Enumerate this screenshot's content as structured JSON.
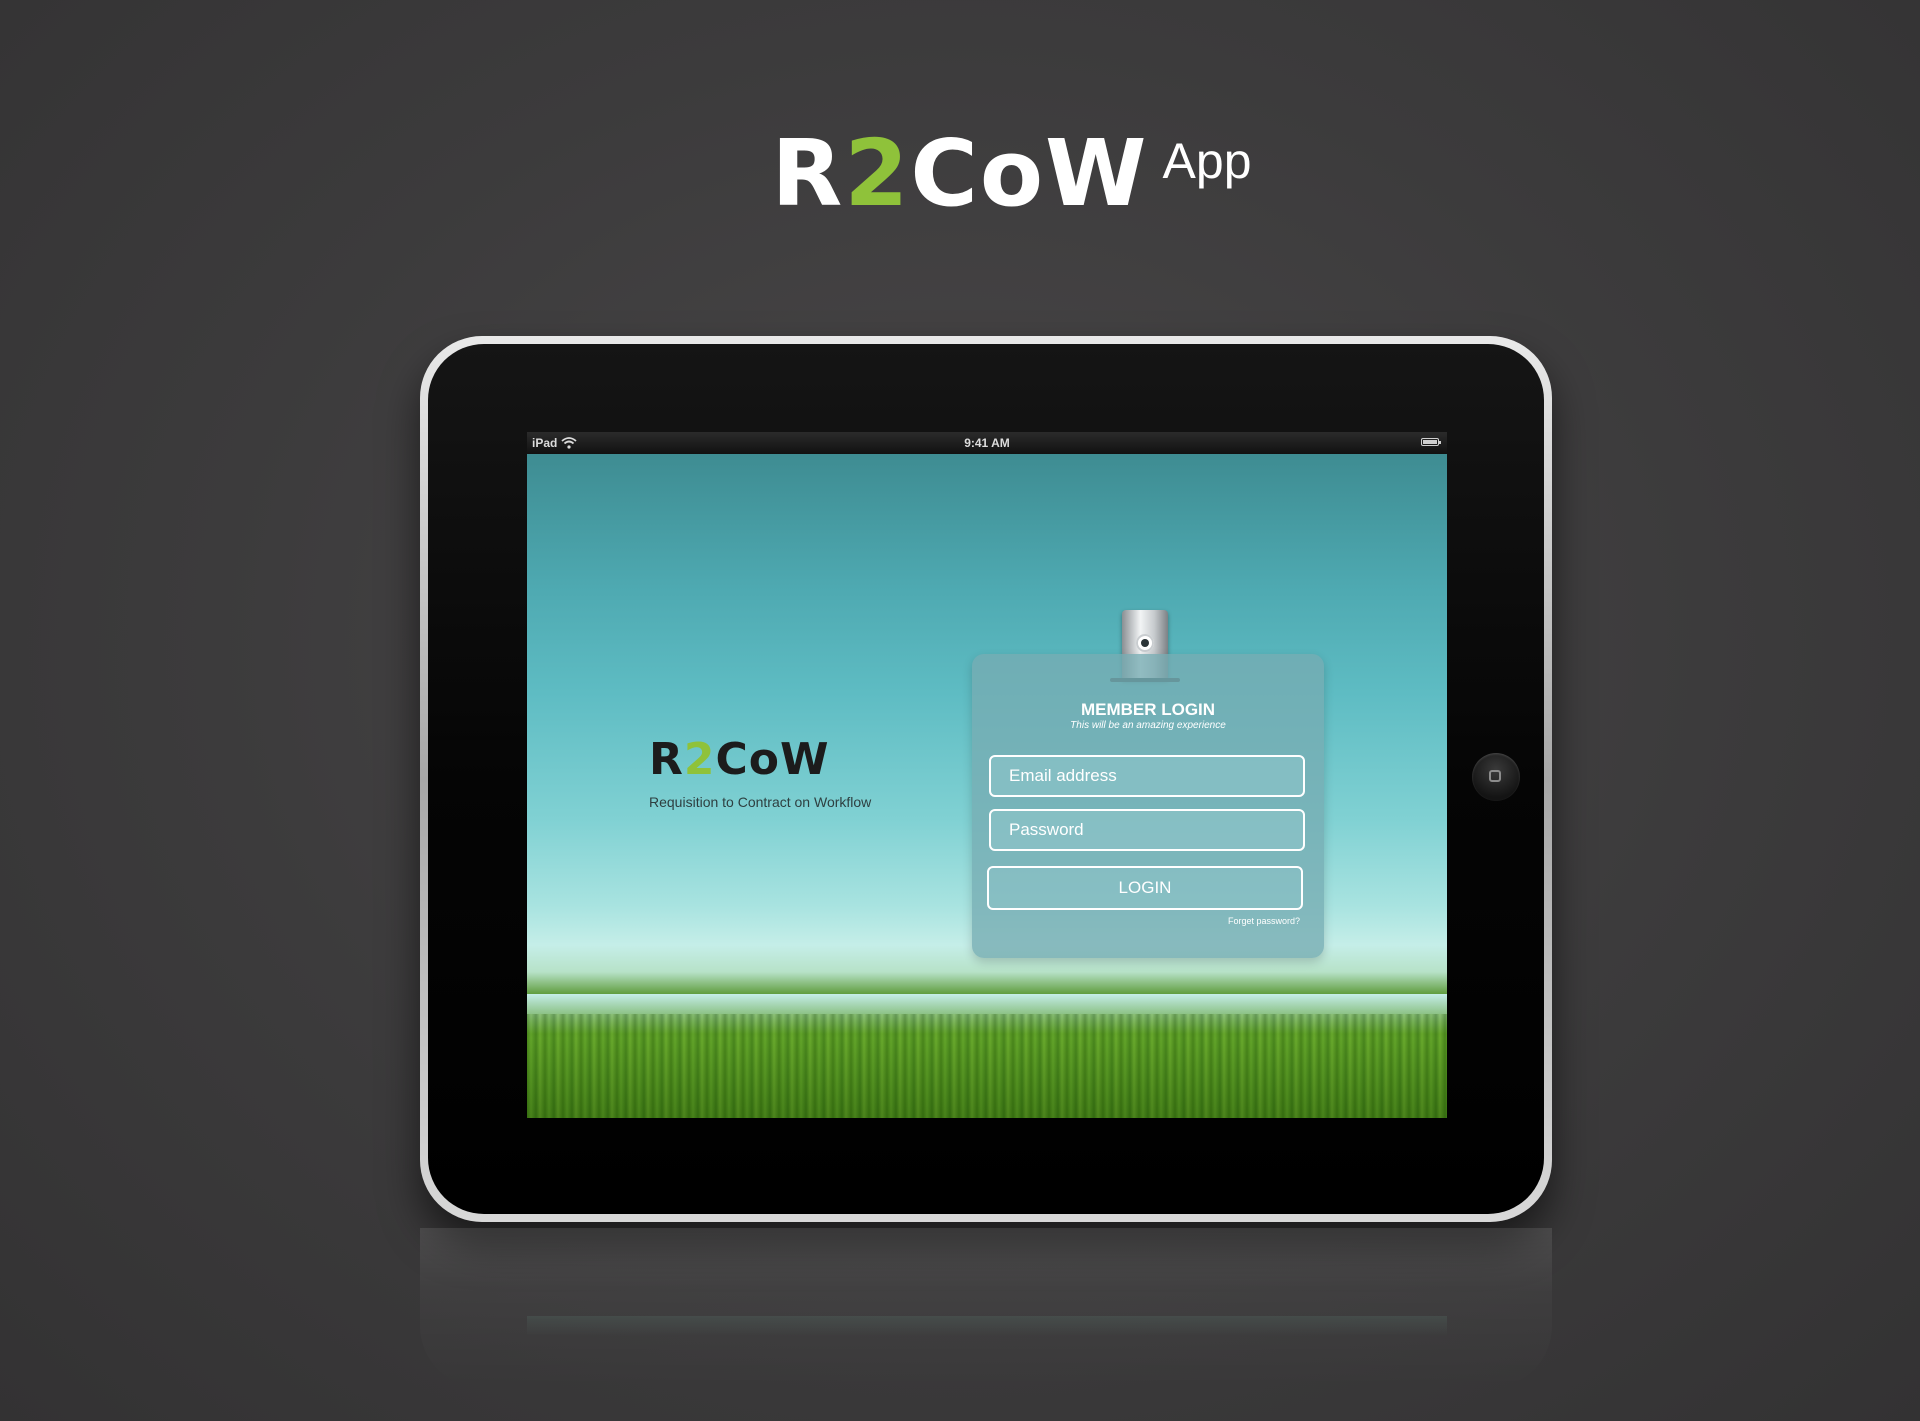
{
  "brand": {
    "wordmark_start": "R",
    "wordmark_accent": "2",
    "wordmark_end": "CoW",
    "suffix": "App",
    "accent_color": "#8fc23a"
  },
  "status_bar": {
    "device": "iPad",
    "time": "9:41 AM"
  },
  "screen_logo": {
    "wordmark_start": "R",
    "wordmark_accent": "2",
    "wordmark_end": "CoW",
    "tagline": "Requisition to Contract on Workflow"
  },
  "login": {
    "title": "MEMBER LOGIN",
    "subtitle": "This will be an amazing experience",
    "email_placeholder": "Email address",
    "password_placeholder": "Password",
    "button_label": "LOGIN",
    "forgot_link": "Forget password?"
  },
  "icons": {
    "status": [
      "wifi-icon",
      "battery-icon"
    ],
    "card": "clip-icon",
    "device": "home-button-icon"
  }
}
